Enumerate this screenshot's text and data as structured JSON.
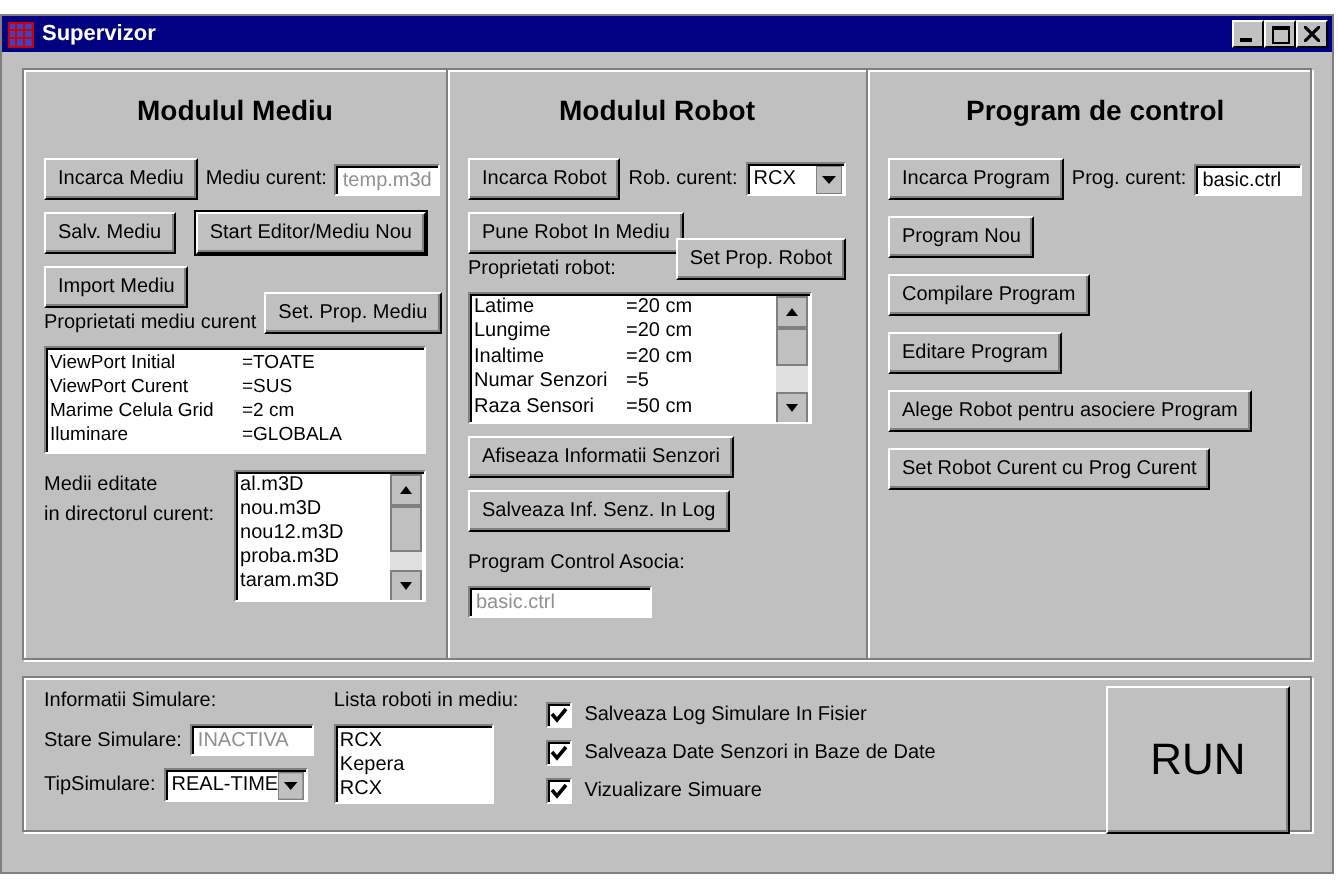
{
  "window": {
    "title": "Supervizor"
  },
  "mediu": {
    "title": "Modulul Mediu",
    "load_button": "Incarca Mediu",
    "current_label": "Mediu curent:",
    "current": {
      "value": "temp.m3d",
      "disabled": true
    },
    "save_button": "Salv. Mediu",
    "editor_button": {
      "label": "Start Editor/Mediu Nou",
      "focused": true
    },
    "import_button": "Import Mediu",
    "props_label": "Proprietati mediu curent",
    "set_props_button": "Set. Prop. Mediu",
    "props": [
      {
        "name": "ViewPort Initial",
        "value": "=TOATE"
      },
      {
        "name": "ViewPort Curent",
        "value": "=SUS"
      },
      {
        "name": "Marime Celula Grid",
        "value": "=2 cm"
      },
      {
        "name": "Iluminare",
        "value": "=GLOBALA"
      }
    ],
    "files_label": "Medii editate\nin directorul curent:",
    "files": [
      "al.m3D",
      "nou.m3D",
      "nou12.m3D",
      "proba.m3D",
      "taram.m3D"
    ]
  },
  "robot": {
    "title": "Modulul Robot",
    "load_button": "Incarca Robot",
    "current_label": "Rob. curent:",
    "current": "RCX",
    "place_button": "Pune Robot In Mediu",
    "set_props_button": "Set Prop. Robot",
    "props_label": "Proprietati robot:",
    "props": [
      {
        "name": "Latime",
        "value": "=20 cm"
      },
      {
        "name": "Lungime",
        "value": "=20 cm"
      },
      {
        "name": "Inaltime",
        "value": "=20 cm"
      },
      {
        "name": "Numar Senzori",
        "value": "=5"
      },
      {
        "name": "Raza Sensori",
        "value": "=50 cm"
      }
    ],
    "sensors_button": "Afiseaza Informatii Senzori",
    "log_button": "Salveaza Inf. Senz. In Log",
    "program_label": "Program Control Asocia:",
    "program": {
      "value": "basic.ctrl",
      "disabled": true
    }
  },
  "program": {
    "title": "Program de control",
    "load_button": "Incarca Program",
    "current_label": "Prog. curent:",
    "current": {
      "value": "basic.ctrl",
      "disabled": false
    },
    "buttons": [
      "Program Nou",
      "Compilare Program",
      "Editare Program",
      "Alege Robot pentru asociere Program",
      "Set Robot Curent cu Prog Curent"
    ]
  },
  "simulation": {
    "info_label": "Informatii Simulare:",
    "state_label": "Stare Simulare:",
    "state": {
      "value": "INACTIVA",
      "disabled": true
    },
    "type_label": "TipSimulare:",
    "type": "REAL-TIME",
    "robots_label": "Lista roboti in mediu:",
    "robots": [
      "RCX",
      "Kepera",
      "RCX"
    ],
    "options": [
      {
        "label": "Salveaza Log Simulare In Fisier",
        "checked": true
      },
      {
        "label": "Salveaza Date Senzori in Baze de Date",
        "checked": true
      },
      {
        "label": "Vizualizare Simuare",
        "checked": true
      }
    ],
    "run_button": "RUN"
  }
}
